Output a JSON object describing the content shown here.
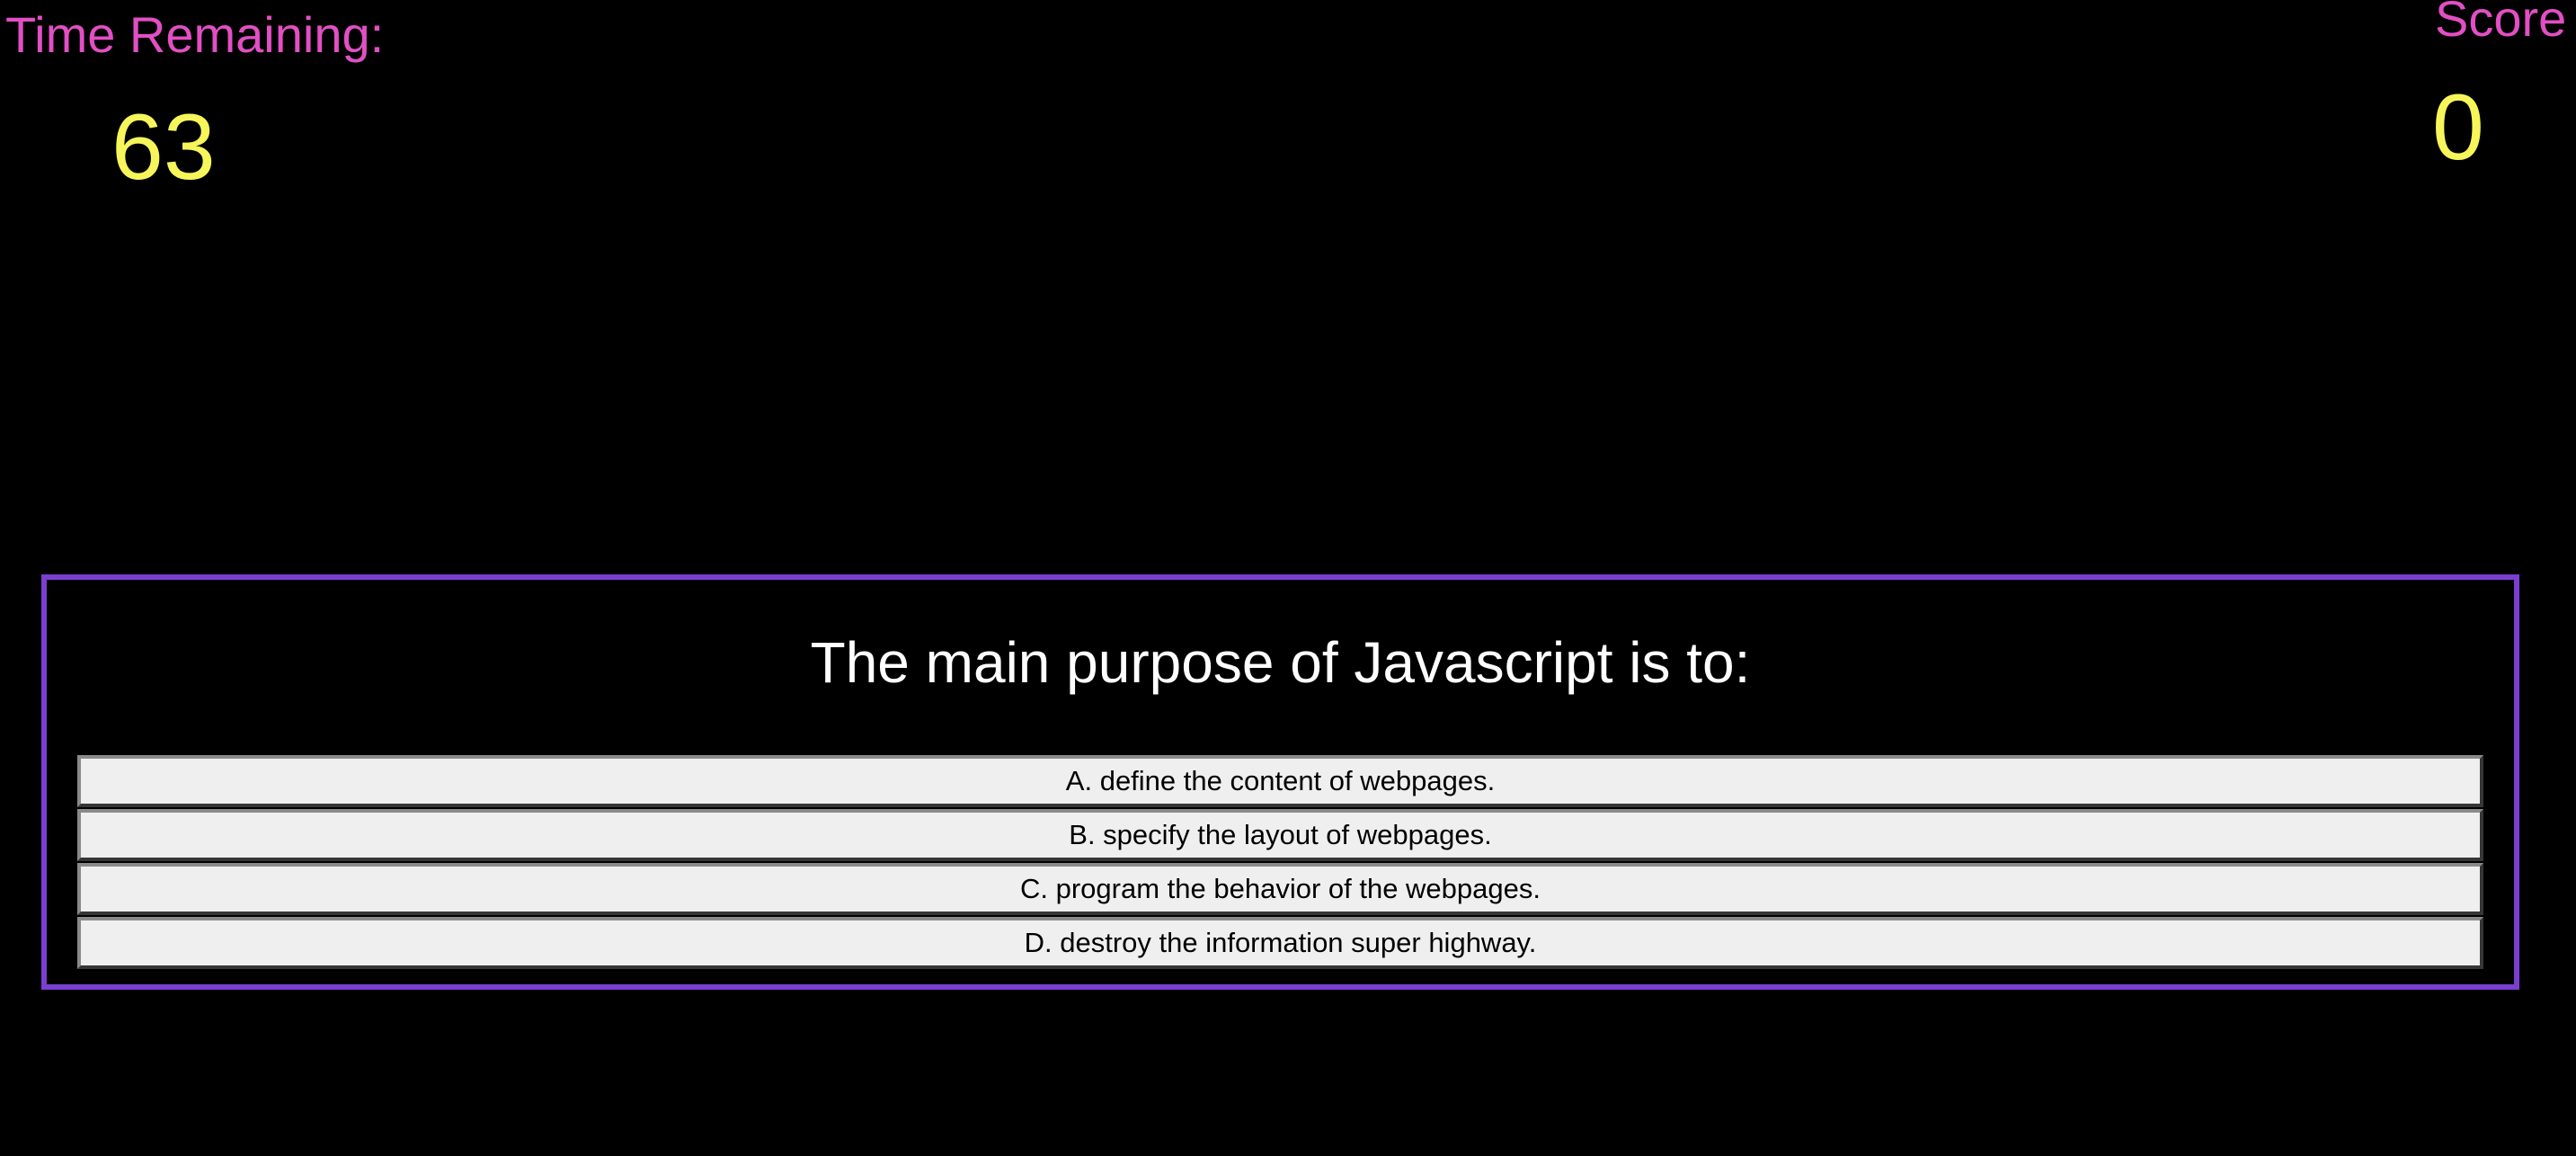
{
  "colors": {
    "background": "#000000",
    "label": "#e24fc4",
    "value": "#f6f65a",
    "question": "#ffffff",
    "box_border": "#7b3fd0",
    "button_bg": "#efefef",
    "button_text": "#000000"
  },
  "timer": {
    "label": "Time Remaining:",
    "value": "63"
  },
  "score": {
    "label": "Score",
    "value": "0"
  },
  "quiz": {
    "question": "The main purpose of Javascript is to:",
    "choices": [
      {
        "label": "A. define the content of webpages."
      },
      {
        "label": "B. specify the layout of webpages."
      },
      {
        "label": "C. program the behavior of the webpages."
      },
      {
        "label": "D. destroy the information super highway."
      }
    ]
  }
}
